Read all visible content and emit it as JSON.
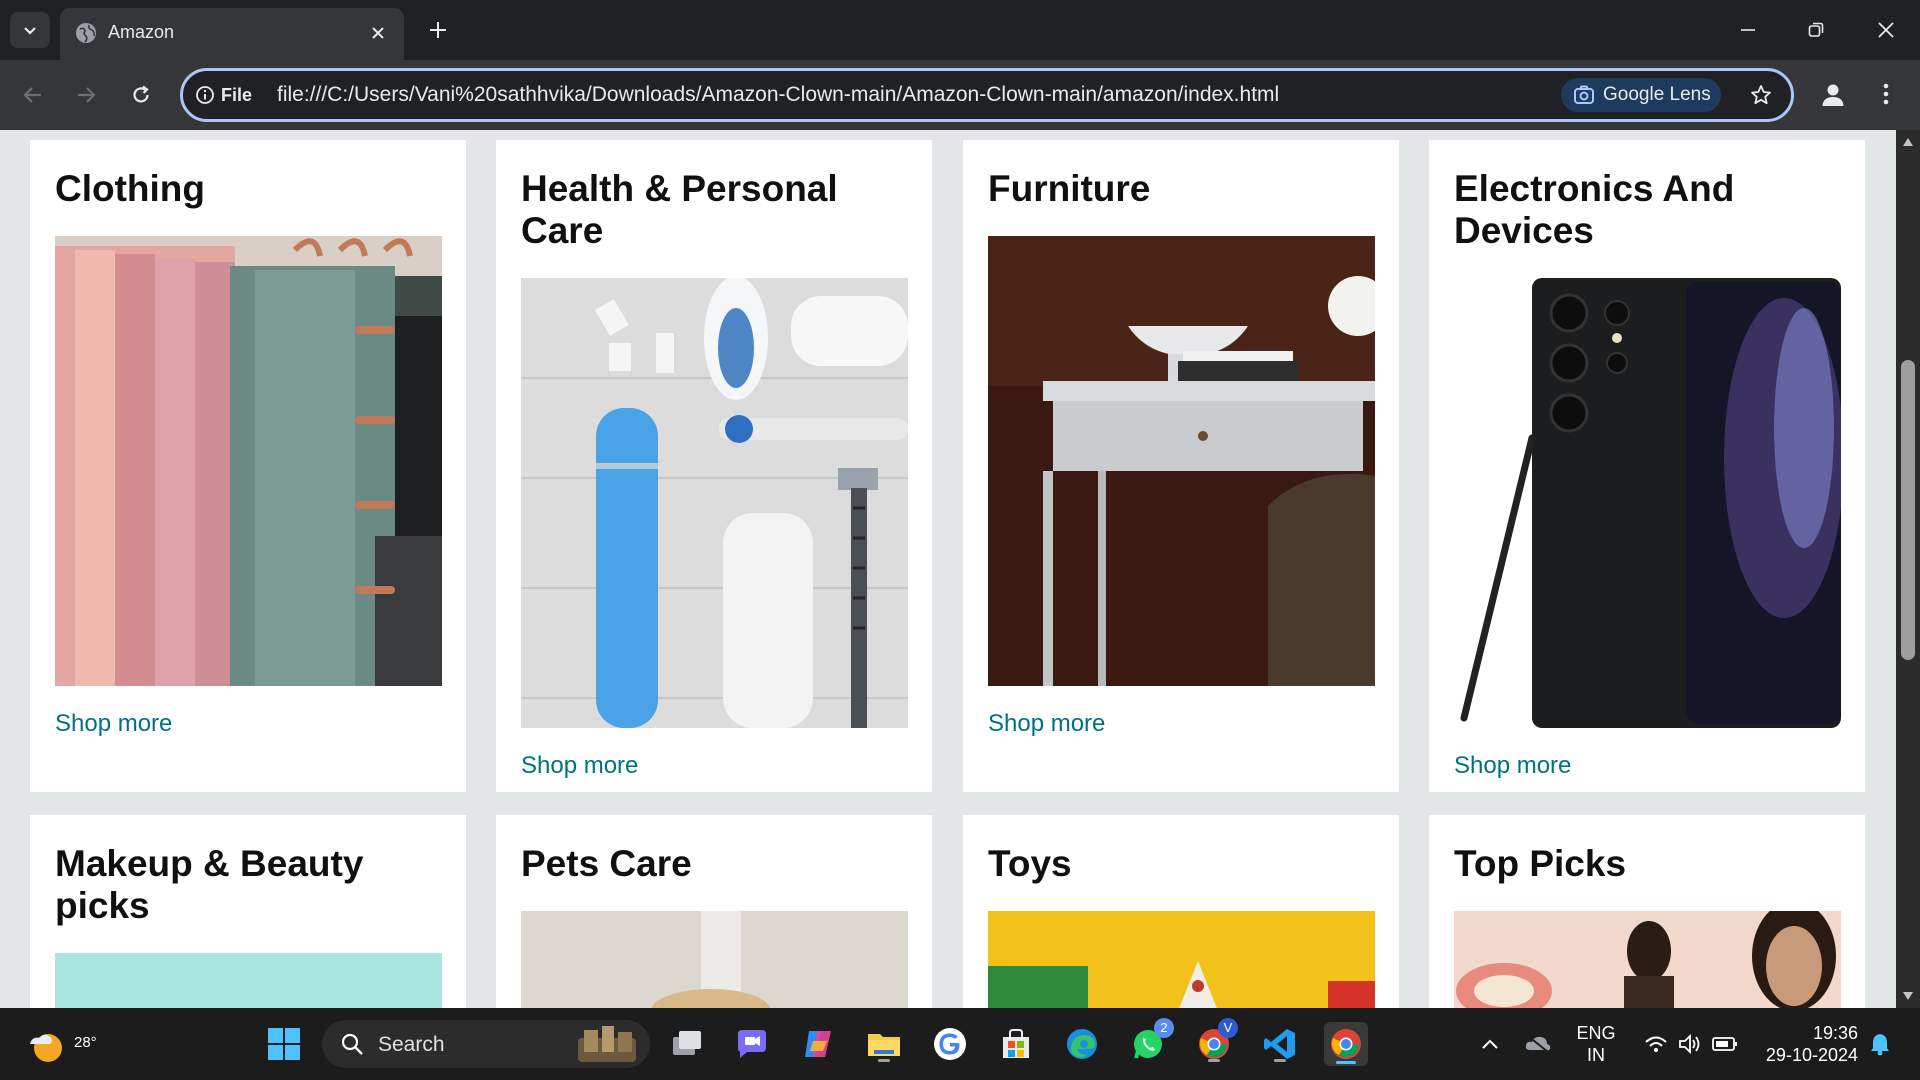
{
  "browser": {
    "tab_title": "Amazon",
    "info_chip_label": "File",
    "url": "file:///C:/Users/Vani%20sathhvika/Downloads/Amazon-Clown-main/Amazon-Clown-main/amazon/index.html",
    "lens_label": "Google Lens",
    "accent_color": "#a8c7fa"
  },
  "cards": [
    {
      "title": "Clothing",
      "link": "Shop more",
      "image": "clothing-hangers-image"
    },
    {
      "title": "Health & Personal Care",
      "link": "Shop more",
      "image": "personal-care-products-image"
    },
    {
      "title": "Furniture",
      "link": "Shop more",
      "image": "desk-furniture-image"
    },
    {
      "title": "Electronics And Devices",
      "link": "Shop more",
      "image": "smartphone-stylus-image"
    },
    {
      "title": "Makeup & Beauty picks",
      "image": "makeup-beauty-image"
    },
    {
      "title": "Pets Care",
      "image": "pets-care-image"
    },
    {
      "title": "Toys",
      "image": "toys-image"
    },
    {
      "title": "Top Picks",
      "image": "top-picks-fashion-image"
    }
  ],
  "page": {
    "link_color": "#007185",
    "background_color": "#e3e6e6"
  },
  "taskbar": {
    "temperature": "28°",
    "search_label": "Search",
    "whatsapp_badge": "2",
    "chrome_profile_badge": "V",
    "language_line1": "ENG",
    "language_line2": "IN",
    "time": "19:36",
    "date": "29-10-2024"
  }
}
